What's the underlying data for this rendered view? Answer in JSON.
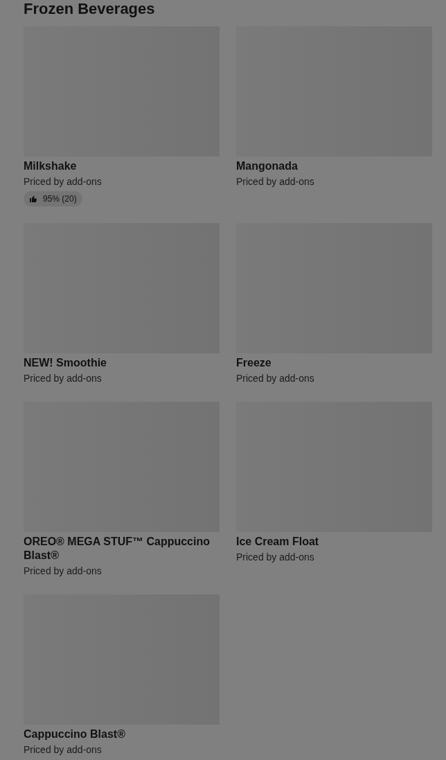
{
  "section": {
    "title": "Frozen Beverages"
  },
  "items": [
    {
      "name": "Milkshake",
      "price": "Priced by add-ons",
      "rating": "95% (20)"
    },
    {
      "name": "Mangonada",
      "price": "Priced by add-ons"
    },
    {
      "name": "NEW! Smoothie",
      "price": "Priced by add-ons"
    },
    {
      "name": "Freeze",
      "price": "Priced by add-ons"
    },
    {
      "name": "OREO® MEGA STUF™ Cappuccino Blast®",
      "price": "Priced by add-ons"
    },
    {
      "name": "Ice Cream Float",
      "price": "Priced by add-ons"
    },
    {
      "name": "Cappuccino Blast®",
      "price": "Priced by add-ons"
    }
  ]
}
